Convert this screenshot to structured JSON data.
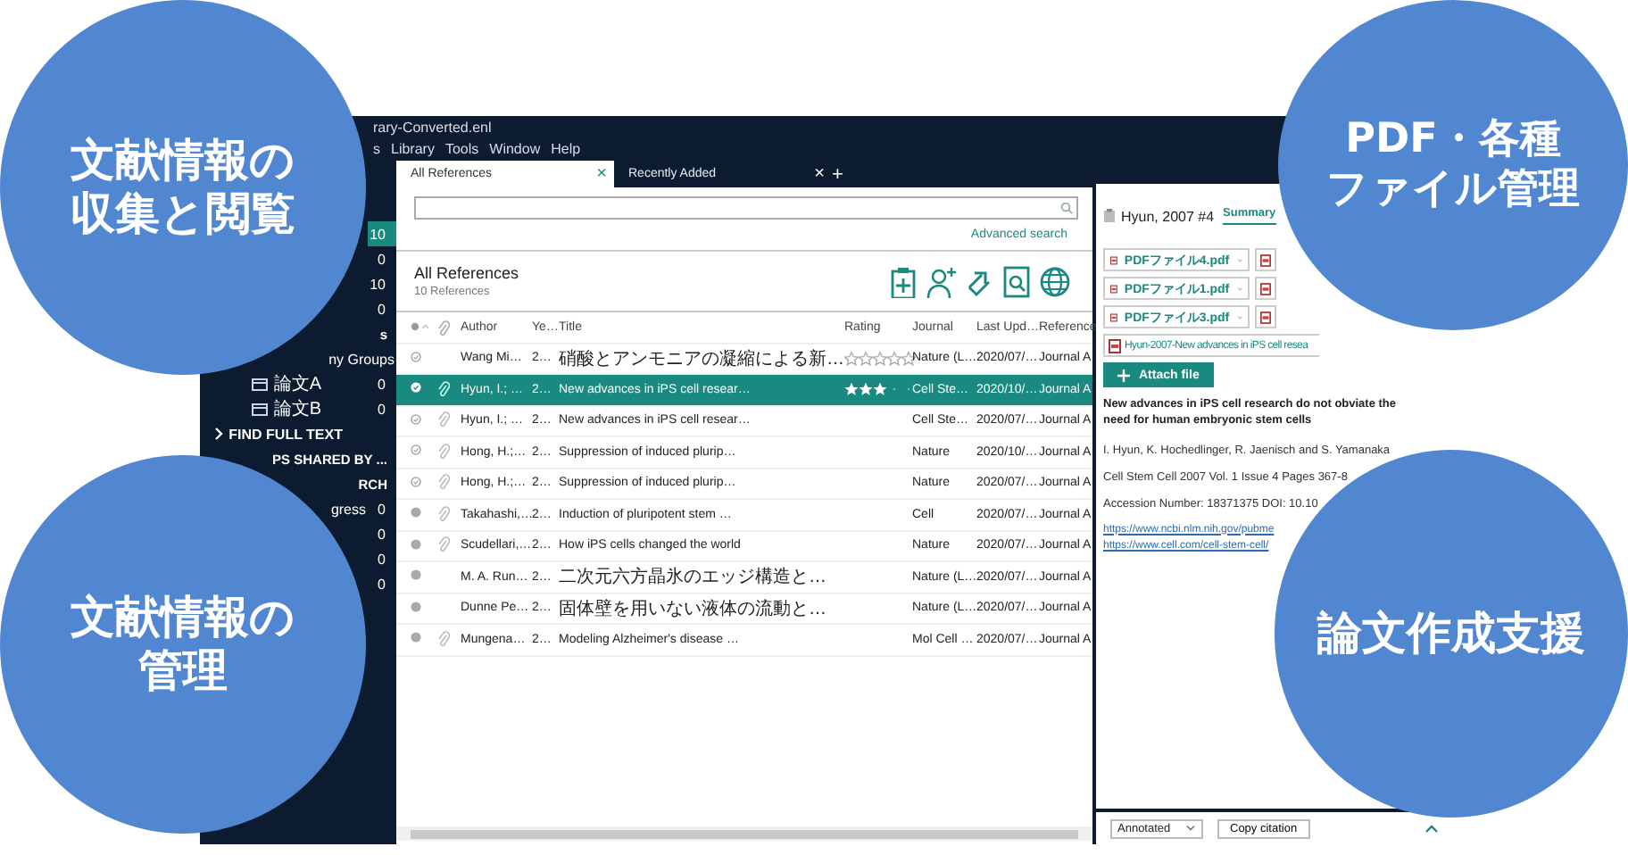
{
  "window": {
    "title": "rary-Converted.enl",
    "menu": [
      "s",
      "Library",
      "Tools",
      "Window",
      "Help"
    ]
  },
  "sidebar": {
    "items": [
      {
        "kind": "count",
        "count": "10",
        "selected": true
      },
      {
        "kind": "count",
        "count": "0",
        "selected": false
      },
      {
        "kind": "count",
        "count": "10",
        "selected": false
      },
      {
        "kind": "count",
        "count": "0",
        "selected": false
      },
      {
        "kind": "heading",
        "label": "s",
        "selected": false
      },
      {
        "kind": "group",
        "label": "ny Groups",
        "selected": false
      },
      {
        "kind": "item",
        "label": "論文A",
        "count": "0",
        "selected": false
      },
      {
        "kind": "item",
        "label": "論文B",
        "count": "0",
        "selected": false
      },
      {
        "kind": "section",
        "label": "FIND FULL TEXT",
        "selected": false
      },
      {
        "kind": "heading",
        "label": "PS SHARED BY ...",
        "selected": false
      },
      {
        "kind": "heading",
        "label": "RCH",
        "selected": false
      },
      {
        "kind": "group",
        "label": "gress",
        "count": "0",
        "selected": false
      },
      {
        "kind": "count",
        "count": "0",
        "selected": false
      },
      {
        "kind": "count",
        "count": "0",
        "selected": false
      },
      {
        "kind": "count",
        "count": "0",
        "selected": false
      }
    ]
  },
  "tabs": [
    {
      "label": "All References",
      "selected": true,
      "close": "×"
    },
    {
      "label": "Recently Added",
      "selected": false,
      "close": "×"
    }
  ],
  "new_tab": "+",
  "search": {
    "advanced": "Advanced search"
  },
  "list_header": {
    "title": "All References",
    "subtitle": "10 References"
  },
  "table": {
    "columns": [
      "Author",
      "Ye…",
      "Title",
      "Rating",
      "Journal",
      "Last Upd…",
      "Reference"
    ],
    "rows": [
      {
        "read": true,
        "attached": false,
        "selected": false,
        "stars": 0,
        "cells": [
          "Wang Mi…",
          "2…",
          "硝酸とアンモニアの凝縮による新…",
          "",
          "Nature (L…",
          "2020/07/…",
          "Journal A"
        ]
      },
      {
        "read": true,
        "attached": true,
        "selected": true,
        "stars": 3,
        "cells": [
          "Hyun, I.; …",
          "2…",
          "New advances in iPS cell resear…",
          "",
          "Cell Ste…",
          "2020/10/…",
          "Journal A"
        ]
      },
      {
        "read": true,
        "attached": true,
        "selected": false,
        "cells": [
          "Hyun, I.; …",
          "2…",
          "New advances in iPS cell resear…",
          "",
          "Cell Ste…",
          "2020/07/…",
          "Journal A"
        ]
      },
      {
        "read": true,
        "attached": true,
        "selected": false,
        "cells": [
          "Hong, H.;…",
          "2…",
          "Suppression of induced plurip…",
          "",
          "Nature",
          "2020/10/…",
          "Journal A"
        ]
      },
      {
        "read": true,
        "attached": true,
        "selected": false,
        "cells": [
          "Hong, H.;…",
          "2…",
          "Suppression of induced plurip…",
          "",
          "Nature",
          "2020/07/…",
          "Journal A"
        ]
      },
      {
        "read": false,
        "attached": true,
        "selected": false,
        "cells": [
          "Takahashi,…",
          "2…",
          "Induction of pluripotent stem …",
          "",
          "Cell",
          "2020/07/…",
          "Journal A"
        ]
      },
      {
        "read": false,
        "attached": true,
        "selected": false,
        "cells": [
          "Scudellari,…",
          "2…",
          "How iPS cells changed the world",
          "",
          "Nature",
          "2020/07/…",
          "Journal A"
        ]
      },
      {
        "read": false,
        "attached": false,
        "selected": false,
        "cells": [
          "M. A. Run…",
          "2…",
          "二次元六方晶氷のエッジ構造と…",
          "",
          "Nature (L…",
          "2020/07/…",
          "Journal A"
        ]
      },
      {
        "read": false,
        "attached": false,
        "selected": false,
        "cells": [
          "Dunne Pe…",
          "2…",
          "固体壁を用いない液体の流動と…",
          "",
          "Nature (L…",
          "2020/07/…",
          "Journal A"
        ]
      },
      {
        "read": false,
        "attached": true,
        "selected": false,
        "cells": [
          "Mungena…",
          "2…",
          "Modeling Alzheimer's disease …",
          "",
          "Mol Cell …",
          "2020/07/…",
          "Journal A"
        ]
      }
    ]
  },
  "detail": {
    "heading": "Hyun, 2007 #4",
    "tabs": [
      {
        "label": "Summary",
        "selected": true
      }
    ],
    "files": [
      {
        "kind": "named",
        "label": "PDFファイル4.pdf"
      },
      {
        "kind": "icon"
      },
      {
        "kind": "named",
        "label": "PDFファイル1.pdf"
      },
      {
        "kind": "icon"
      },
      {
        "kind": "named",
        "label": "PDFファイル3.pdf"
      },
      {
        "kind": "icon"
      }
    ],
    "main_file": "Hyun-2007-New advances in iPS cell resea",
    "attach_button": "Attach file",
    "title": "New advances in iPS cell research do not obviate the need for human embryonic stem cells",
    "authors": "I. Hyun, K. Hochedlinger, R. Jaenisch and S. Yamanaka",
    "source": "Cell Stem Cell 2007 Vol. 1 Issue 4 Pages 367-8",
    "accession": "Accession Number: 18371375 DOI: 10.10",
    "links": [
      "https://www.ncbi.nlm.nih.gov/pubme",
      "https://www.cell.com/cell-stem-cell/"
    ],
    "style_select": "Annotated",
    "copy_button": "Copy citation"
  },
  "features": [
    {
      "lines": [
        "文献情報の",
        "収集と閲覧"
      ]
    },
    {
      "lines": [
        "PDF・各種",
        "ファイル管理"
      ]
    },
    {
      "lines": [
        "文献情報の",
        "管理"
      ]
    },
    {
      "lines": [
        "論文作成支援"
      ]
    }
  ]
}
